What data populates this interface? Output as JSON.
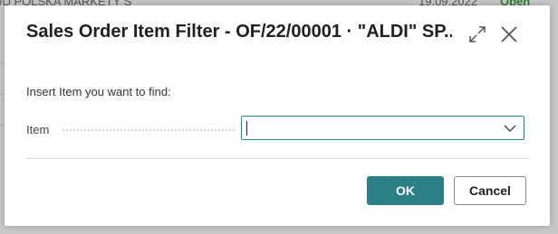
{
  "background": {
    "top_left_text": "JD POLSKA MARKETY S",
    "top_date": "19.09.2022",
    "top_status": "Open",
    "status_color": "#2e7d32"
  },
  "dialog": {
    "title": "Sales Order Item Filter - OF/22/00001 · \"ALDI\" SP...",
    "expand_icon": "expand-icon",
    "close_icon": "close-icon",
    "prompt": "Insert Item you want to find:",
    "item_label": "Item",
    "item_value": "",
    "ok_label": "OK",
    "cancel_label": "Cancel",
    "accent_color": "#2c7f86"
  }
}
